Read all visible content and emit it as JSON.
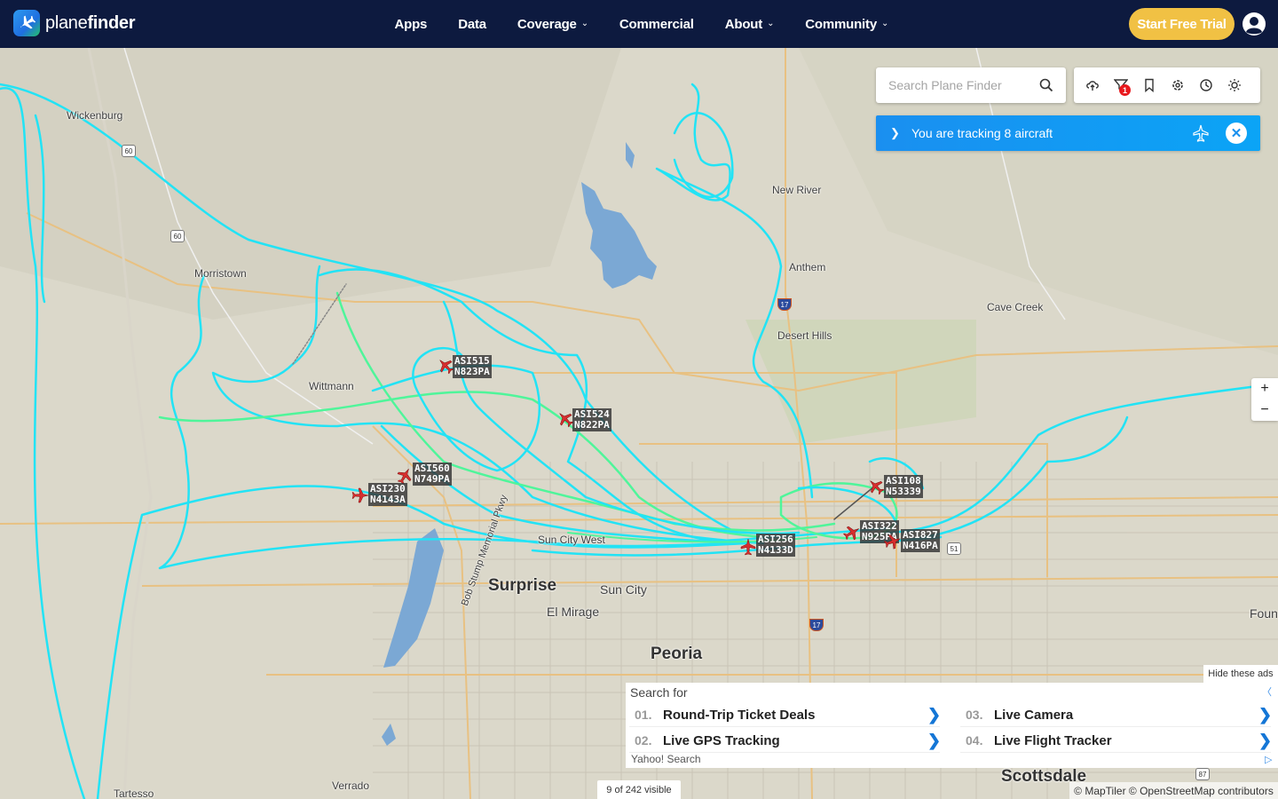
{
  "header": {
    "logo_text_light": "plane",
    "logo_text_bold": "finder",
    "nav": [
      {
        "label": "Apps",
        "has_dropdown": false
      },
      {
        "label": "Data",
        "has_dropdown": false
      },
      {
        "label": "Coverage",
        "has_dropdown": true
      },
      {
        "label": "Commercial",
        "has_dropdown": false
      },
      {
        "label": "About",
        "has_dropdown": true
      },
      {
        "label": "Community",
        "has_dropdown": true
      }
    ],
    "trial_button": "Start Free Trial",
    "user_icon": "user-circle-icon"
  },
  "search": {
    "placeholder": "Search Plane Finder",
    "icon": "search-icon"
  },
  "toolbar": {
    "icons": [
      "cloud-upload-icon",
      "filter-icon",
      "bookmark-icon",
      "settings-icon",
      "history-icon",
      "weather-icon"
    ],
    "filter_badge": "1"
  },
  "tracking_banner": {
    "message": "You are tracking 8 aircraft",
    "accent": "#1a8ff0"
  },
  "zoom": {
    "in": "+",
    "out": "−"
  },
  "map": {
    "track_color": "#22e3f5",
    "track_color_alt": "#4ff59a",
    "places": [
      {
        "name": "Wickenburg"
      },
      {
        "name": "Morristown"
      },
      {
        "name": "Wittmann"
      },
      {
        "name": "New River"
      },
      {
        "name": "Anthem"
      },
      {
        "name": "Cave Creek"
      },
      {
        "name": "Desert Hills"
      },
      {
        "name": "Surprise"
      },
      {
        "name": "Sun City"
      },
      {
        "name": "El Mirage"
      },
      {
        "name": "Peoria"
      },
      {
        "name": "Scottsdale"
      },
      {
        "name": "Tartesso"
      },
      {
        "name": "Verrado"
      },
      {
        "name": "Foun"
      },
      {
        "name": "Bob Stump Memorial Pkwy"
      },
      {
        "name": "Sun City West"
      }
    ],
    "shields": [
      "60",
      "60",
      "17",
      "17",
      "51",
      "87"
    ]
  },
  "aircraft": [
    {
      "callsign": "ASI515",
      "reg": "N823PA"
    },
    {
      "callsign": "ASI524",
      "reg": "N822PA"
    },
    {
      "callsign": "ASI560",
      "reg": "N749PA"
    },
    {
      "callsign": "ASI230",
      "reg": "N4143A"
    },
    {
      "callsign": "ASI108",
      "reg": "N53339"
    },
    {
      "callsign": "ASI322",
      "reg": "N925PA"
    },
    {
      "callsign": "ASI827",
      "reg": "N416PA"
    },
    {
      "callsign": "ASI256",
      "reg": "N4133D"
    }
  ],
  "ads": {
    "hide_label": "Hide these ads",
    "search_for": "Search for",
    "items": [
      {
        "num": "01.",
        "text": "Round-Trip Ticket Deals"
      },
      {
        "num": "02.",
        "text": "Live GPS Tracking"
      },
      {
        "num": "03.",
        "text": "Live Camera"
      },
      {
        "num": "04.",
        "text": "Live Flight Tracker"
      }
    ],
    "provider": "Yahoo! Search"
  },
  "status": {
    "visible_count": "9 of 242 visible",
    "attribution": "© MapTiler © OpenStreetMap contributors"
  }
}
